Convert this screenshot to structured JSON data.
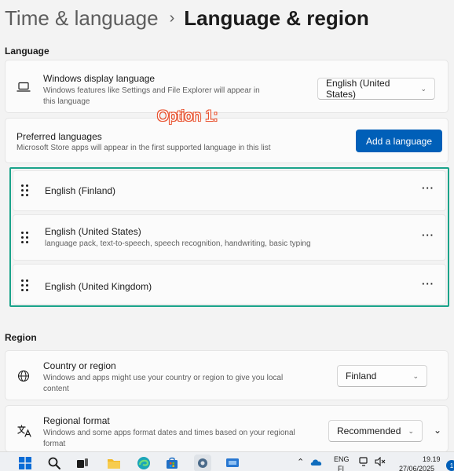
{
  "header": {
    "parent": "Time & language",
    "separator": "›",
    "current": "Language & region"
  },
  "language_section": {
    "label": "Language",
    "display_language": {
      "title": "Windows display language",
      "description": "Windows features like Settings and File Explorer will appear in this language",
      "value": "English (United States)"
    },
    "preferred": {
      "title": "Preferred languages",
      "description": "Microsoft Store apps will appear in the first supported language in this list",
      "add_button": "Add a language"
    },
    "annotation": "Option 1:",
    "languages": [
      {
        "name": "English (Finland)",
        "detail": ""
      },
      {
        "name": "English (United States)",
        "detail": "language pack, text-to-speech, speech recognition, handwriting, basic typing"
      },
      {
        "name": "English (United Kingdom)",
        "detail": ""
      }
    ],
    "more_glyph": "···"
  },
  "region_section": {
    "label": "Region",
    "country": {
      "title": "Country or region",
      "description": "Windows and apps might use your country or region to give you local content",
      "value": "Finland"
    },
    "format": {
      "title": "Regional format",
      "description": "Windows and some apps format dates and times based on your regional format",
      "value": "Recommended"
    }
  },
  "taskbar": {
    "lang_top": "ENG",
    "lang_bottom": "FI",
    "time": "19.19",
    "date": "27/06/2025",
    "notification_count": "1"
  },
  "colors": {
    "accent": "#005fb8",
    "highlight_border": "#1aa38a",
    "annotation": "#e8502d"
  }
}
